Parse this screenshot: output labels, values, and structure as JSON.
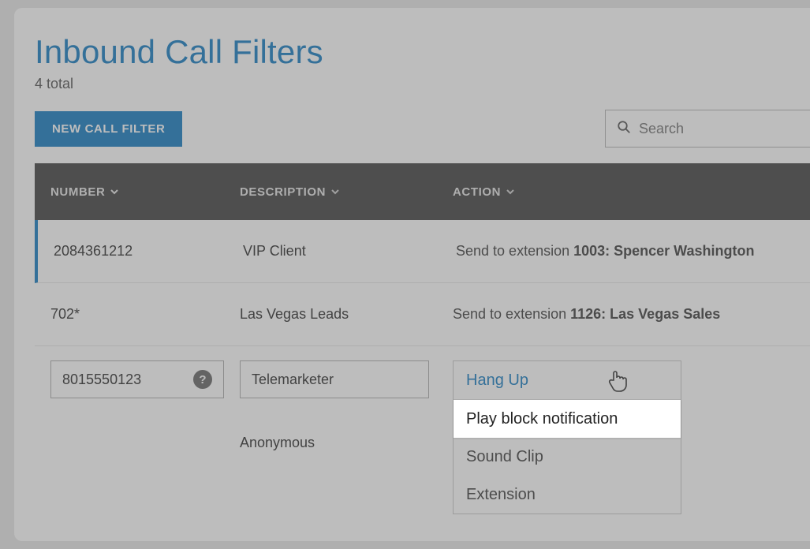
{
  "page": {
    "title": "Inbound Call Filters",
    "subtitle": "4 total"
  },
  "toolbar": {
    "new_filter_label": "NEW CALL FILTER",
    "search_placeholder": "Search"
  },
  "table": {
    "headers": {
      "number": "NUMBER",
      "description": "DESCRIPTION",
      "action": "ACTION"
    },
    "rows": [
      {
        "number": "2084361212",
        "description": "VIP Client",
        "action_prefix": "Send to extension ",
        "action_bold": "1003: Spencer Washington"
      },
      {
        "number": "702*",
        "description": "Las Vegas Leads",
        "action_prefix": "Send to extension ",
        "action_bold": "1126: Las Vegas Sales"
      }
    ],
    "edit_row": {
      "number": "8015550123",
      "description": "Telemarketer",
      "help_icon": "?",
      "dropdown": {
        "selected": "Hang Up",
        "options": [
          "Play block notification",
          "Sound Clip",
          "Extension"
        ]
      }
    },
    "last_row": {
      "description": "Anonymous"
    }
  },
  "highlight_option": "Play block notification"
}
